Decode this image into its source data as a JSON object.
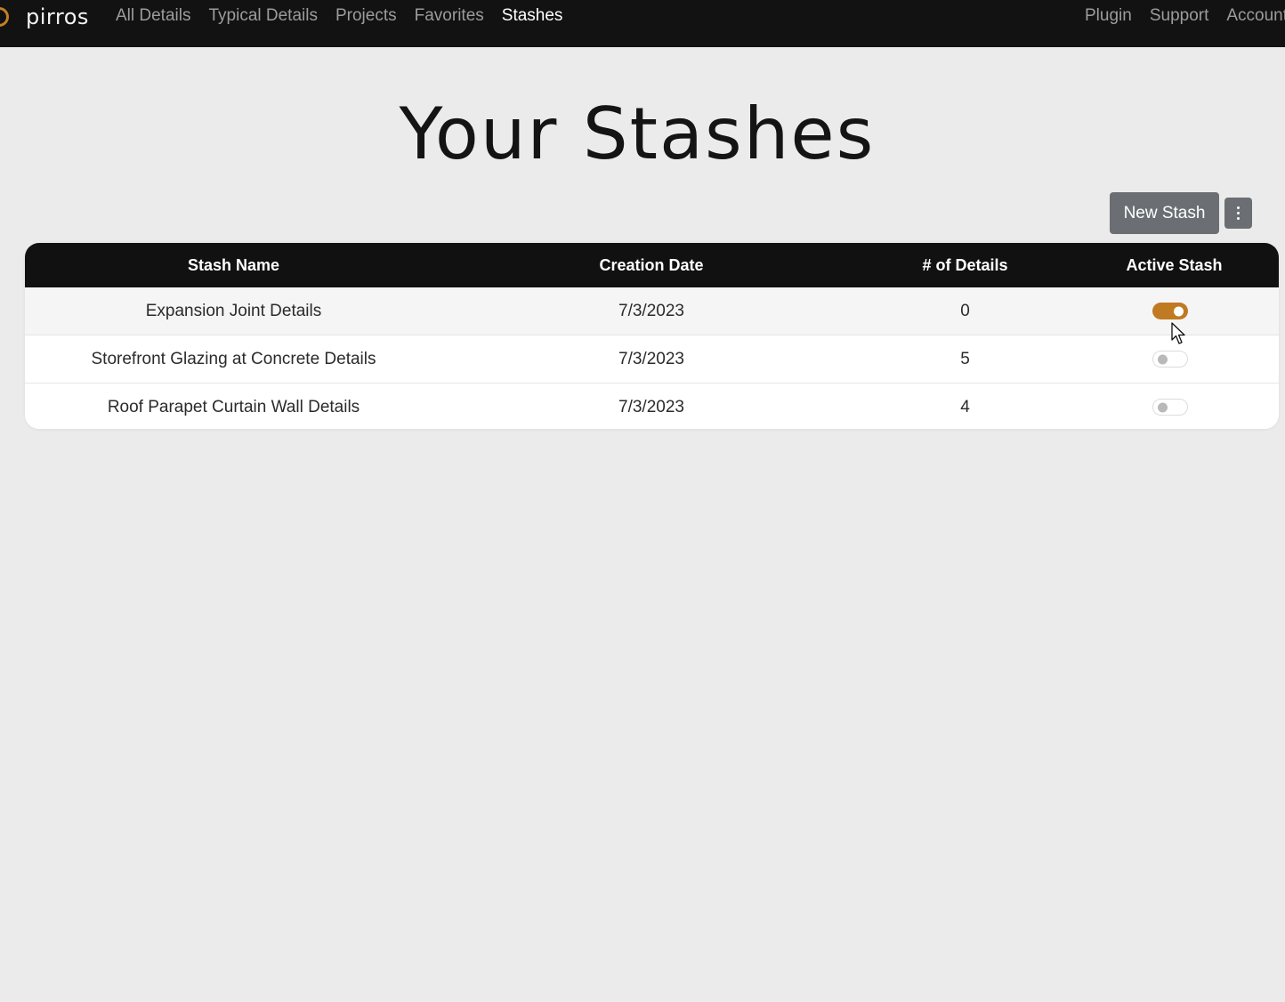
{
  "brand": {
    "name": "pirros",
    "accent_color": "#c07a22"
  },
  "nav": {
    "left": [
      {
        "label": "All Details"
      },
      {
        "label": "Typical Details"
      },
      {
        "label": "Projects"
      },
      {
        "label": "Favorites"
      },
      {
        "label": "Stashes",
        "active": true
      }
    ],
    "right": [
      {
        "label": "Plugin"
      },
      {
        "label": "Support"
      },
      {
        "label": "Account"
      }
    ]
  },
  "page": {
    "title": "Your Stashes"
  },
  "toolbar": {
    "new_stash_label": "New Stash",
    "more_icon": "vertical-dots-icon"
  },
  "table": {
    "headers": [
      "Stash Name",
      "Creation Date",
      "# of Details",
      "Active Stash"
    ],
    "rows": [
      {
        "name": "Expansion Joint Details",
        "date": "7/3/2023",
        "details": "0",
        "active": true
      },
      {
        "name": "Storefront Glazing at Concrete Details",
        "date": "7/3/2023",
        "details": "5",
        "active": false
      },
      {
        "name": "Roof Parapet Curtain Wall Details",
        "date": "7/3/2023",
        "details": "4",
        "active": false
      }
    ]
  }
}
